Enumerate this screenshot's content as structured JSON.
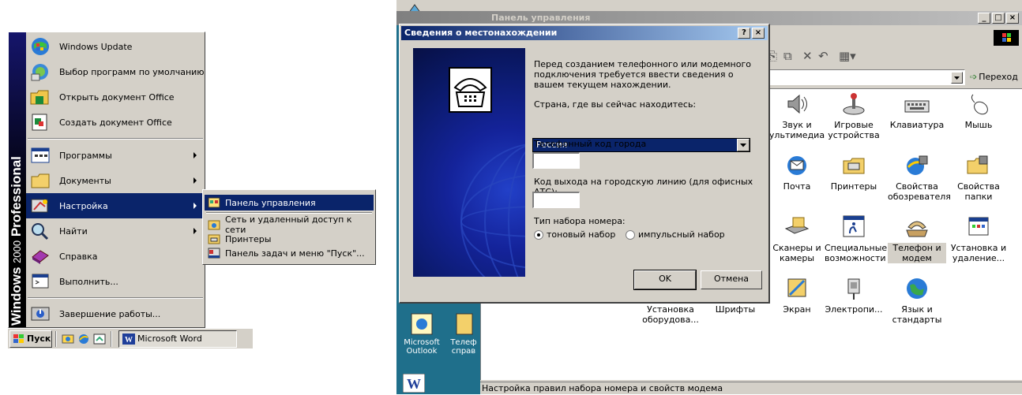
{
  "start_menu": {
    "brand": {
      "word1": "Windows",
      "year": "2000",
      "word2": "Professional"
    },
    "top_items": [
      {
        "label": "Windows Update",
        "icon": "windows-update-icon"
      },
      {
        "label": "Выбор программ по умолчанию",
        "icon": "default-programs-icon"
      },
      {
        "label": "Открыть документ Office",
        "icon": "open-office-doc-icon"
      },
      {
        "label": "Создать документ Office",
        "icon": "new-office-doc-icon"
      }
    ],
    "main_items": [
      {
        "label": "Программы",
        "icon": "programs-icon",
        "submenu": true
      },
      {
        "label": "Документы",
        "icon": "documents-icon",
        "submenu": true
      },
      {
        "label": "Настройка",
        "icon": "settings-icon",
        "submenu": true,
        "selected": true
      },
      {
        "label": "Найти",
        "icon": "search-icon",
        "submenu": true
      },
      {
        "label": "Справка",
        "icon": "help-icon"
      },
      {
        "label": "Выполнить...",
        "icon": "run-icon"
      }
    ],
    "shutdown": {
      "label": "Завершение работы...",
      "icon": "shutdown-icon"
    }
  },
  "settings_submenu": [
    {
      "label": "Панель управления",
      "icon": "control-panel-icon",
      "selected": true
    },
    {
      "label": "Сеть и удаленный доступ к сети",
      "icon": "network-icon"
    },
    {
      "label": "Принтеры",
      "icon": "printers-icon"
    },
    {
      "label": "Панель задач и меню \"Пуск\"...",
      "icon": "taskbar-icon"
    }
  ],
  "taskbar": {
    "start_label": "Пуск",
    "task_label": "Microsoft Word"
  },
  "control_panel": {
    "title": "Панель управления",
    "go_label": "Переход",
    "status": "Настройка правил набора номера и свойств модема",
    "desktop_icons": [
      {
        "label": "Microsoft Outlook"
      },
      {
        "label": "Телеф справ"
      }
    ],
    "items": [
      {
        "label": "Звук и ультимедиа",
        "icon": "speaker-icon"
      },
      {
        "label": "Игровые устройства",
        "icon": "joystick-icon"
      },
      {
        "label": "Клавиатура",
        "icon": "keyboard-icon"
      },
      {
        "label": "Мышь",
        "icon": "mouse-icon"
      },
      {
        "label": "Почта",
        "icon": "mail-icon"
      },
      {
        "label": "Принтеры",
        "icon": "printer-icon"
      },
      {
        "label": "Свойства обозревателя",
        "icon": "internet-options-icon"
      },
      {
        "label": "Свойства папки",
        "icon": "folder-options-icon"
      },
      {
        "label": "Сканеры и камеры",
        "icon": "scanner-icon"
      },
      {
        "label": "Специальные возможности",
        "icon": "accessibility-icon"
      },
      {
        "label": "Телефон и модем",
        "icon": "phone-modem-icon",
        "selected": true
      },
      {
        "label": "Установка и удаление...",
        "icon": "add-remove-icon"
      },
      {
        "label": "Установка оборудова...",
        "icon": "add-hardware-icon"
      },
      {
        "label": "Шрифты",
        "icon": "fonts-icon"
      },
      {
        "label": "Экран",
        "icon": "display-icon"
      },
      {
        "label": "Электропи...",
        "icon": "power-icon"
      },
      {
        "label": "Язык и стандарты",
        "icon": "regional-icon"
      }
    ]
  },
  "dialog": {
    "title": "Сведения о местонахождении",
    "help_btn": "?",
    "close_btn": "×",
    "intro": "Перед созданием телефонного или модемного подключения требуется ввести сведения о вашем текущем нахождении.",
    "country_label": "Страна, где вы сейчас находитесь:",
    "country_value": "Россия",
    "area_code_label": "Телефонный код города",
    "area_code_value": "",
    "outside_line_label": "Код выхода на городскую линию (для офисных АТС):",
    "outside_line_value": "",
    "dial_type_label": "Тип набора номера:",
    "dial_tone_label": "тоновый набор",
    "dial_pulse_label": "импульсный набор",
    "dial_type_selected": "tone",
    "ok_label": "OK",
    "cancel_label": "Отмена"
  }
}
